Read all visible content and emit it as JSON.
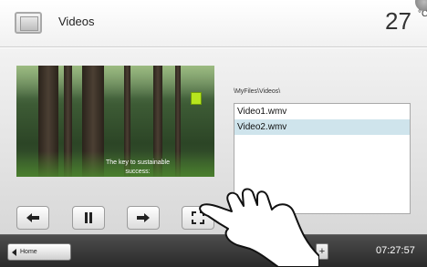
{
  "header": {
    "title": "Videos",
    "temperature": "27",
    "temperature_unit": "°C"
  },
  "video": {
    "caption_line1": "The key to sustainable",
    "caption_line2": "success:"
  },
  "browser": {
    "path": "\\MyFiles\\Videos\\",
    "files": [
      {
        "name": "Video1.wmv",
        "selected": false
      },
      {
        "name": "Video2.wmv",
        "selected": true
      }
    ]
  },
  "controls": {
    "icons": [
      "arrow-left-icon",
      "pause-icon",
      "arrow-right-icon",
      "fullscreen-icon"
    ]
  },
  "footer": {
    "home_label": "Home",
    "plus_label": "+",
    "time": "07:27:57"
  }
}
